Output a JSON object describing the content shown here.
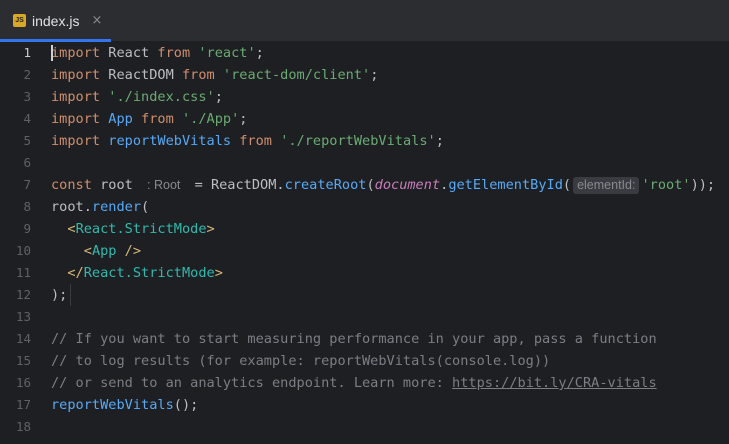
{
  "tab": {
    "badge": "JS",
    "filename": "index.js",
    "close": "×"
  },
  "line_numbers": [
    "1",
    "2",
    "3",
    "4",
    "5",
    "6",
    "7",
    "8",
    "9",
    "10",
    "11",
    "12",
    "13",
    "14",
    "15",
    "16",
    "17",
    "18"
  ],
  "code": {
    "l1": {
      "kw1": "import",
      "name": " React ",
      "kw2": "from",
      "sp": " ",
      "str": "'react'",
      "end": ";"
    },
    "l2": {
      "kw1": "import",
      "name": " ReactDOM ",
      "kw2": "from",
      "sp": " ",
      "str": "'react-dom/client'",
      "end": ";"
    },
    "l3": {
      "kw1": "import",
      "sp": " ",
      "str": "'./index.css'",
      "end": ";"
    },
    "l4": {
      "kw1": "import",
      "sp1": " ",
      "name": "App",
      "sp2": " ",
      "kw2": "from",
      "sp3": " ",
      "str": "'./App'",
      "end": ";"
    },
    "l5": {
      "kw1": "import",
      "sp1": " ",
      "name": "reportWebVitals",
      "sp2": " ",
      "kw2": "from",
      "sp3": " ",
      "str": "'./reportWebVitals'",
      "end": ";"
    },
    "l7": {
      "kw": "const",
      "name": " root ",
      "type_hint": ": Root",
      "eq": " = ReactDOM.",
      "fn": "createRoot",
      "p1": "(",
      "doc": "document",
      "dot": ".",
      "fn2": "getElementById",
      "p2": "(",
      "param_hint": "elementId:",
      "str": "'root'",
      "end": "));"
    },
    "l8": {
      "obj": "root.",
      "fn": "render",
      "end": "("
    },
    "l9": {
      "indent": "  ",
      "lt": "<",
      "tag": "React.StrictMode",
      "gt": ">"
    },
    "l10": {
      "indent": "    ",
      "lt": "<",
      "tag": "App",
      "close": " />"
    },
    "l11": {
      "indent": "  ",
      "lt": "</",
      "tag": "React.StrictMode",
      "gt": ">"
    },
    "l12": {
      "text": ");"
    },
    "l14": {
      "text": "// If you want to start measuring performance in your app, pass a function"
    },
    "l15": {
      "text": "// to log results (for example: reportWebVitals(console.log))"
    },
    "l16": {
      "text": "// or send to an analytics endpoint. Learn more: ",
      "link": "https://bit.ly/CRA-vitals"
    },
    "l17": {
      "fn": "reportWebVitals",
      "end": "();"
    }
  },
  "colors": {
    "background": "#1e1f22",
    "tabbar": "#2b2d30",
    "accent": "#3574f0",
    "keyword": "#cf8e6d",
    "string": "#6aab73",
    "function": "#57aaf7",
    "comment": "#7a7e85",
    "jsx_tag": "#2fbaad"
  }
}
